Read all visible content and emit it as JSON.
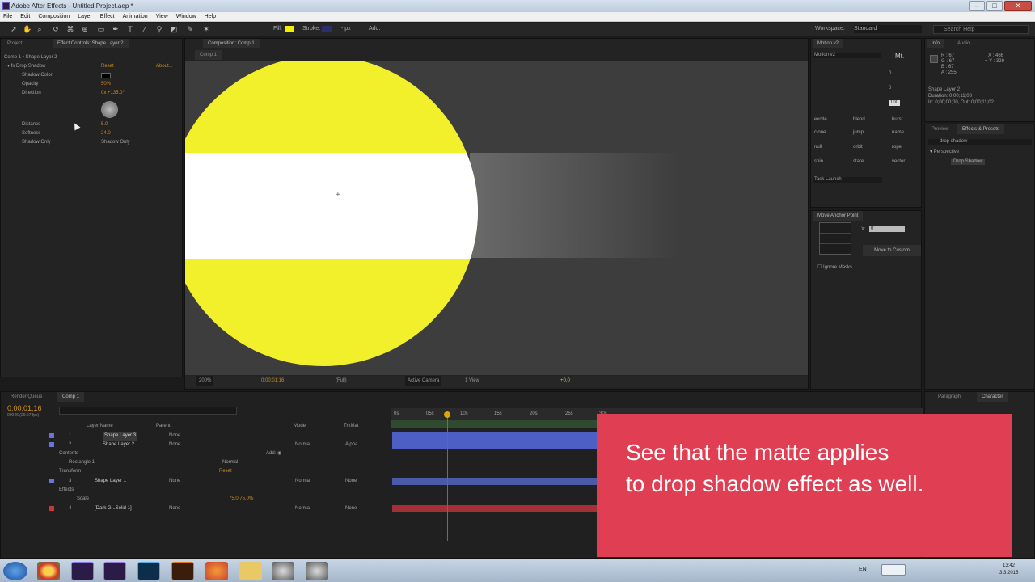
{
  "window": {
    "title": "Adobe After Effects - Untitled Project.aep *",
    "btn_min": "–",
    "btn_max": "□",
    "btn_close": "✕"
  },
  "menu": [
    "File",
    "Edit",
    "Composition",
    "Layer",
    "Effect",
    "Animation",
    "View",
    "Window",
    "Help"
  ],
  "toolbar": {
    "fill_label": "Fill:",
    "stroke_label": "Stroke:",
    "stroke_value": "- px",
    "add_label": "Add:",
    "workspace_label": "Workspace:",
    "workspace_value": "Standard",
    "search_placeholder": "Search Help",
    "fill_color": "#f3ee00",
    "stroke_color": "#2b2f6b"
  },
  "left_panel": {
    "tab_project": "Project",
    "tab_effect_controls": "Effect Controls: Shape Layer 2",
    "breadcrumb": "Comp 1 • Shape Layer 2",
    "effect_name": "Drop Shadow",
    "reset": "Reset",
    "about": "About...",
    "props": [
      {
        "name": "Shadow Color",
        "value": ""
      },
      {
        "name": "Opacity",
        "value": "50%"
      },
      {
        "name": "Direction",
        "value": "0x +135.0°"
      },
      {
        "name": "Distance",
        "value": "5.0"
      },
      {
        "name": "Softness",
        "value": "24.0"
      },
      {
        "name": "Shadow Only",
        "value": "Shadow Only"
      }
    ]
  },
  "comp_panel": {
    "tab": "Composition: Comp 1",
    "subtab": "Comp 1",
    "zoom": "200%",
    "timecode": "0;00;01;16",
    "resolution": "(Full)",
    "camera": "Active Camera",
    "views": "1 View",
    "offset": "+0.0"
  },
  "motion_panel": {
    "tab": "Motion v2",
    "logo": "Mt.",
    "preset": "Motion v2",
    "field1": "0",
    "field2": "0",
    "field3": "100",
    "buttons": [
      "excite",
      "blend",
      "burst",
      "clone",
      "jump",
      "name",
      "null",
      "orbit",
      "rope",
      "spin",
      "stare",
      "vector"
    ],
    "task_launch": "Task Launch"
  },
  "anchor_panel": {
    "tab": "Move Anchor Point",
    "x_label": "X:",
    "y_label": "Y:",
    "x_value": "0",
    "move_btn": "Move to Custom",
    "ignore_masks": "Ignore Masks"
  },
  "info_panel": {
    "tab_info": "Info",
    "tab_audio": "Audio",
    "r": "R : 67",
    "g": "G : 67",
    "b": "B : 67",
    "a": "A : 255",
    "x": "X : 466",
    "y": "+ Y : 329",
    "layer": "Shape Layer 2",
    "duration": "Duration: 0;00;11;03",
    "inout": "In: 0;00;00;00, Out: 0;00;11;02"
  },
  "effects_panel": {
    "tab_preview": "Preview",
    "tab_effects": "Effects & Presets",
    "search": "drop shadow",
    "category": "Perspective",
    "item": "Drop Shadow"
  },
  "timeline": {
    "tab_render": "Render Queue",
    "tab_comp": "Comp 1",
    "timecode": "0;00;01;16",
    "fps": "00046 (29.97 fps)",
    "headers": {
      "layer_name": "Layer Name",
      "parent": "Parent",
      "mode": "Mode",
      "trkmat": "TrkMat"
    },
    "ruler": [
      "0s",
      "05s",
      "10s",
      "15s",
      "20s",
      "25s",
      "30s"
    ],
    "rows": [
      {
        "num": "1",
        "name": "Shape Layer 3",
        "parent": "None",
        "mode": "",
        "trkmat": "",
        "color": "#6c73d6"
      },
      {
        "num": "2",
        "name": "Shape Layer 2",
        "parent": "None",
        "mode": "Normal",
        "trkmat": "Alpha",
        "color": "#6c73d6"
      },
      {
        "num": "",
        "name": "Contents",
        "parent": "",
        "mode": "Add: ◉",
        "trkmat": "",
        "color": ""
      },
      {
        "num": "",
        "name": "Rectangle 1",
        "parent": "",
        "mode": "Normal",
        "trkmat": "",
        "color": ""
      },
      {
        "num": "",
        "name": "Transform",
        "parent": "",
        "mode": "Reset",
        "trkmat": "",
        "color": ""
      },
      {
        "num": "3",
        "name": "Shape Layer 1",
        "parent": "None",
        "mode": "Normal",
        "trkmat": "None",
        "color": "#6c73d6"
      },
      {
        "num": "",
        "name": "Effects",
        "parent": "",
        "mode": "",
        "trkmat": "",
        "color": ""
      },
      {
        "num": "",
        "name": "Scale",
        "parent": "",
        "mode": "",
        "trkmat": "",
        "color": ""
      },
      {
        "num": "4",
        "name": "[Dark G...Solid 1]",
        "parent": "None",
        "mode": "Normal",
        "trkmat": "None",
        "color": "#c8373c"
      }
    ],
    "scale_value": "75.0,75.0%"
  },
  "right_bottom": {
    "tab_paragraph": "Paragraph",
    "tab_character": "Character"
  },
  "caption": {
    "line1": "See that the matte applies",
    "line2": "to drop shadow effect as well."
  },
  "taskbar": {
    "lang": "EN",
    "time": "13:42",
    "date": "3.3.2015"
  }
}
